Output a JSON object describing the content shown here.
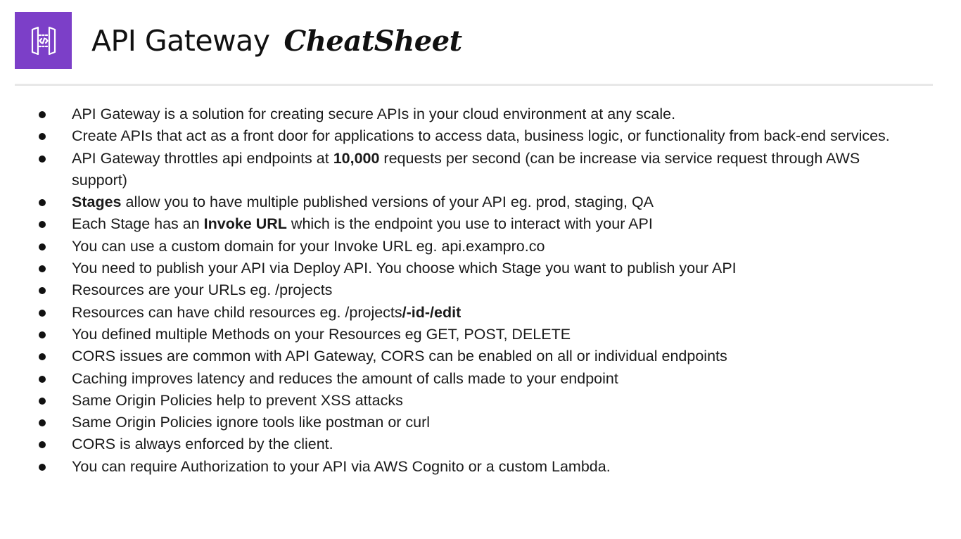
{
  "header": {
    "title_main": "API Gateway",
    "title_script": "CheatSheet",
    "logo_icon": "api-gateway-icon",
    "logo_color": "#7c3fc8"
  },
  "bullets": [
    {
      "segments": [
        {
          "t": "API Gateway is a solution for creating secure APIs in your cloud environment at any scale."
        }
      ]
    },
    {
      "segments": [
        {
          "t": "Create APIs that act as a front door for applications to access data, business logic, or functionality from back-end services."
        }
      ]
    },
    {
      "segments": [
        {
          "t": "API Gateway throttles api endpoints at "
        },
        {
          "t": "10,000",
          "b": true
        },
        {
          "t": " requests per second (can be increase via service request through AWS support)"
        }
      ]
    },
    {
      "segments": [
        {
          "t": "Stages",
          "b": true
        },
        {
          "t": " allow you to have multiple published versions of your API eg. prod, staging, QA"
        }
      ]
    },
    {
      "segments": [
        {
          "t": "Each Stage has an "
        },
        {
          "t": "Invoke URL",
          "b": true
        },
        {
          "t": " which is the endpoint you use to interact with your API"
        }
      ]
    },
    {
      "segments": [
        {
          "t": "You can use a custom domain for your Invoke URL eg. api.exampro.co"
        }
      ]
    },
    {
      "segments": [
        {
          "t": "You need to publish your API via Deploy API. You choose which Stage you want to publish your API"
        }
      ]
    },
    {
      "segments": [
        {
          "t": "Resources are your URLs eg. /projects"
        }
      ]
    },
    {
      "segments": [
        {
          "t": "Resources can have child resources eg. /projects"
        },
        {
          "t": "/-id-/edit",
          "b": true
        }
      ]
    },
    {
      "segments": [
        {
          "t": "You defined multiple Methods on your Resources eg GET, POST, DELETE"
        }
      ]
    },
    {
      "segments": [
        {
          "t": "CORS issues are common with API Gateway, CORS can be enabled on all or individual endpoints"
        }
      ]
    },
    {
      "segments": [
        {
          "t": "Caching improves latency and reduces the amount of calls made to your endpoint"
        }
      ]
    },
    {
      "segments": [
        {
          "t": "Same Origin Policies help to prevent XSS attacks"
        }
      ]
    },
    {
      "segments": [
        {
          "t": "Same Origin Policies ignore tools like postman or curl"
        }
      ]
    },
    {
      "segments": [
        {
          "t": "CORS is always enforced by the client."
        }
      ]
    },
    {
      "segments": [
        {
          "t": "You can require  Authorization to your API via AWS Cognito or a custom Lambda."
        }
      ]
    }
  ]
}
